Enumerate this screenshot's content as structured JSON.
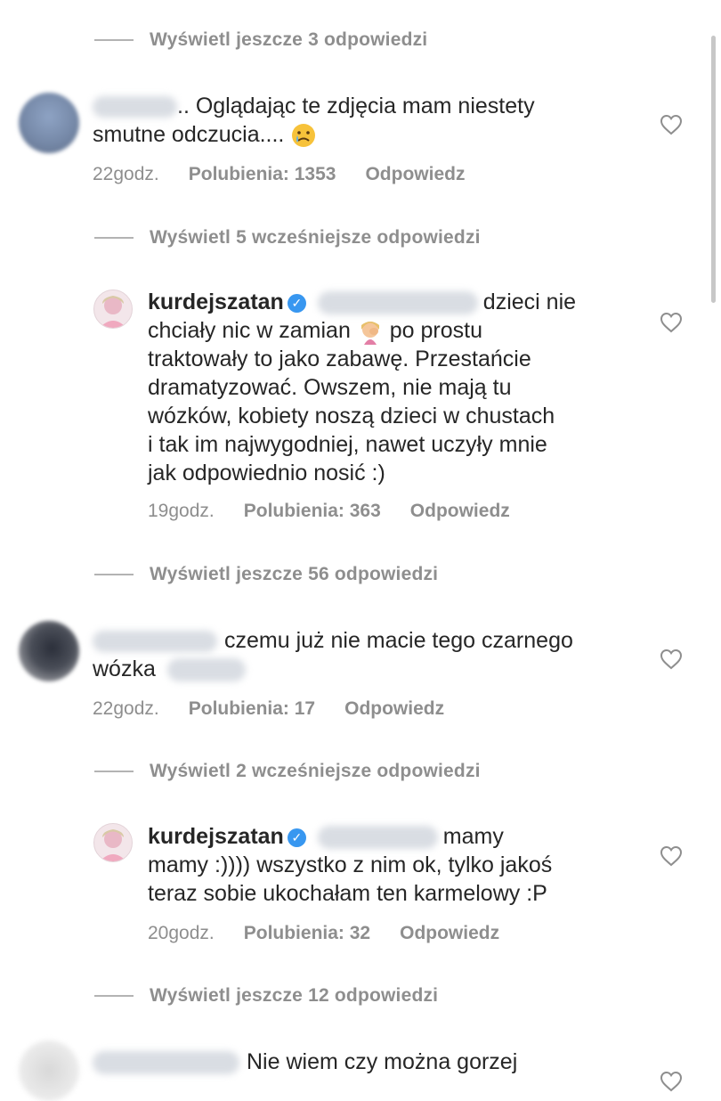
{
  "threads": [
    {
      "view_more": "Wyświetl jeszcze 3 odpowiedzi"
    },
    {
      "text_1": ".. Oglądając te zdjęcia mam niestety",
      "text_2": "smutne odczucia....",
      "time": "22godz.",
      "likes": "Polubienia: 1353",
      "reply": "Odpowiedz"
    },
    {
      "view_more": "Wyświetl 5 wcześniejsze odpowiedzi"
    },
    {
      "username": "kurdejszatan",
      "text_1": "dzieci nie",
      "text_2": "chciały nic w zamian",
      "text_2b": "po prostu",
      "text_3": "traktowały to jako zabawę. Przestańcie",
      "text_4": "dramatyzować. Owszem, nie mają tu",
      "text_5": "wózków, kobiety noszą dzieci w chustach",
      "text_6": "i tak im najwygodniej, nawet uczyły mnie",
      "text_7": "jak odpowiednio nosić :)",
      "time": "19godz.",
      "likes": "Polubienia: 363",
      "reply": "Odpowiedz"
    },
    {
      "view_more": "Wyświetl jeszcze 56 odpowiedzi"
    },
    {
      "text_1": "czemu już nie macie tego czarnego",
      "text_2": "wózka",
      "time": "22godz.",
      "likes": "Polubienia: 17",
      "reply": "Odpowiedz"
    },
    {
      "view_more": "Wyświetl 2 wcześniejsze odpowiedzi"
    },
    {
      "username": "kurdejszatan",
      "text_1": "mamy",
      "text_2": "mamy :)))) wszystko z nim ok, tylko jakoś",
      "text_3": "teraz sobie ukochałam ten karmelowy :P",
      "time": "20godz.",
      "likes": "Polubienia: 32",
      "reply": "Odpowiedz"
    },
    {
      "view_more": "Wyświetl jeszcze 12 odpowiedzi"
    },
    {
      "text_1": "Nie wiem czy można gorzej"
    }
  ],
  "icons": {
    "heart": "heart-outline-icon",
    "verified": "verified-badge-icon",
    "crying": "crying-face-emoji",
    "facepalm": "facepalm-emoji"
  },
  "colors": {
    "meta_gray": "#8e8e8e",
    "verified_blue": "#3897f0",
    "text": "#262626"
  }
}
